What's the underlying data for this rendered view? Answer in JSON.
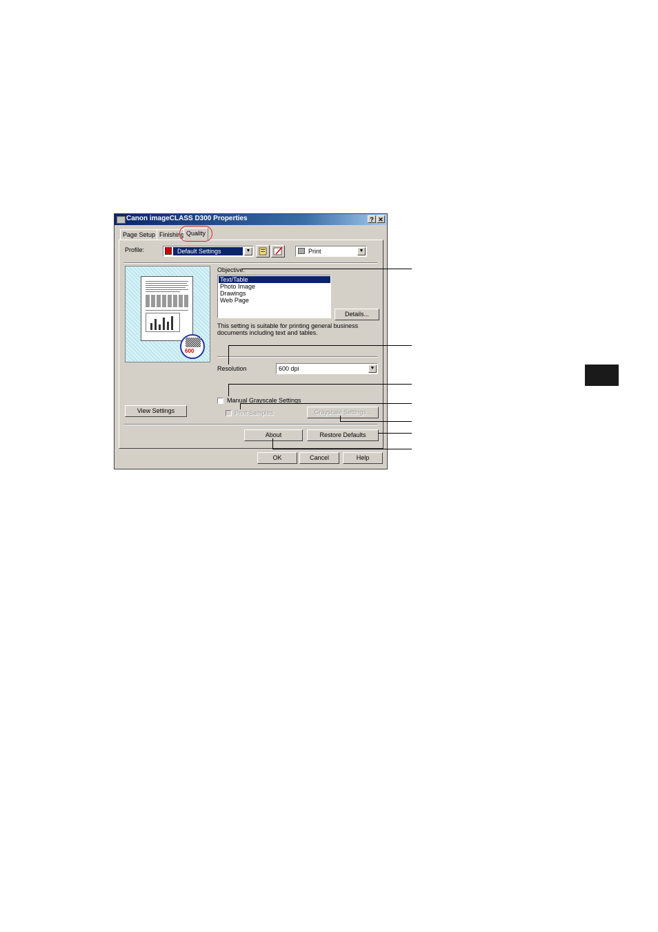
{
  "window": {
    "title": "Canon imageCLASS D300 Properties",
    "help_btn": "?",
    "close_btn": "✕"
  },
  "tabs": [
    {
      "label": "Page Setup"
    },
    {
      "label": "Finishing"
    },
    {
      "label": "Quality"
    }
  ],
  "profile": {
    "label": "Profile:",
    "value": "Default Settings",
    "output_value": "Print"
  },
  "preview": {
    "dpi_badge": "600"
  },
  "objective": {
    "label": "Objective:",
    "options": [
      "Text/Table",
      "Photo Image",
      "Drawings",
      "Web Page"
    ],
    "selected": "Text/Table",
    "details_button": "Details...",
    "description": "This setting is suitable for printing general business documents including text and tables."
  },
  "resolution": {
    "label": "Resolution",
    "value": "600 dpi"
  },
  "grayscale": {
    "manual_label": "Manual Grayscale Settings",
    "print_samples_label": "Print Samples",
    "settings_button": "Grayscale Settings..."
  },
  "buttons": {
    "view_settings": "View Settings",
    "about": "About",
    "restore_defaults": "Restore Defaults",
    "ok": "OK",
    "cancel": "Cancel",
    "help": "Help"
  }
}
